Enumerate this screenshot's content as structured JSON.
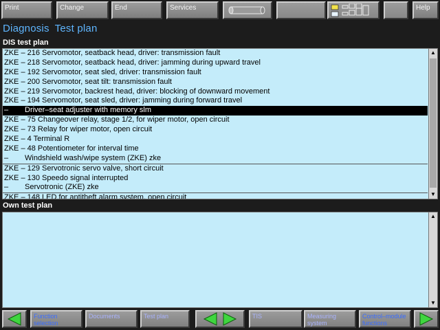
{
  "toolbar": {
    "print": "Print",
    "change": "Change",
    "end": "End",
    "services": "Services",
    "help": "Help"
  },
  "title": {
    "part1": "Diagnosis",
    "part2": "Test plan"
  },
  "dis_section": {
    "heading": "DIS test plan",
    "rows": [
      {
        "text": "ZKE – 216 Servomotor, seatback head, driver: transmission fault"
      },
      {
        "text": "ZKE – 218 Servomotor, seatback head, driver: jamming during upward travel"
      },
      {
        "text": "ZKE – 192 Servomotor, seat sled, driver: transmission fault"
      },
      {
        "text": "ZKE – 200 Servomotor, seat tilt: transmission fault"
      },
      {
        "text": "ZKE – 219 Servomotor, backrest head, driver: blocking of downward movement"
      },
      {
        "text": "ZKE – 194 Servomotor, seat sled, driver: jamming during forward travel"
      },
      {
        "text": "Driver–seat adjuster with memory  slm",
        "dash": "–",
        "selected": true
      },
      {
        "text": "ZKE – 75 Changeover relay, stage 1/2, for wiper motor, open circuit"
      },
      {
        "text": "ZKE – 73 Relay for wiper motor, open circuit"
      },
      {
        "text": "ZKE – 4 Terminal R"
      },
      {
        "text": "ZKE – 48 Potentiometer for interval time"
      },
      {
        "text": "Windshield wash/wipe system (ZKE)  zke",
        "dash": "–"
      },
      {
        "text": "ZKE – 129 Servotronic servo valve, short circuit",
        "separator": true
      },
      {
        "text": "ZKE – 130 Speedo signal interrupted"
      },
      {
        "text": "Servotronic (ZKE)  zke",
        "dash": "–"
      },
      {
        "text": "ZKE – 148 LED for antitheft alarm system, open circuit",
        "separator": true
      }
    ]
  },
  "own_section": {
    "heading": "Own test plan"
  },
  "bottombar": {
    "function_selection": "Function selection",
    "documents": "Documents",
    "test_plan": "Test plan",
    "tis": "TIS",
    "measuring_system": "Measuring system",
    "control_module_functions": "Control–module functions"
  },
  "colors": {
    "list_bg": "#c4ecfa",
    "title": "#5fb6ff",
    "arrow_green": "#3fd63f"
  }
}
